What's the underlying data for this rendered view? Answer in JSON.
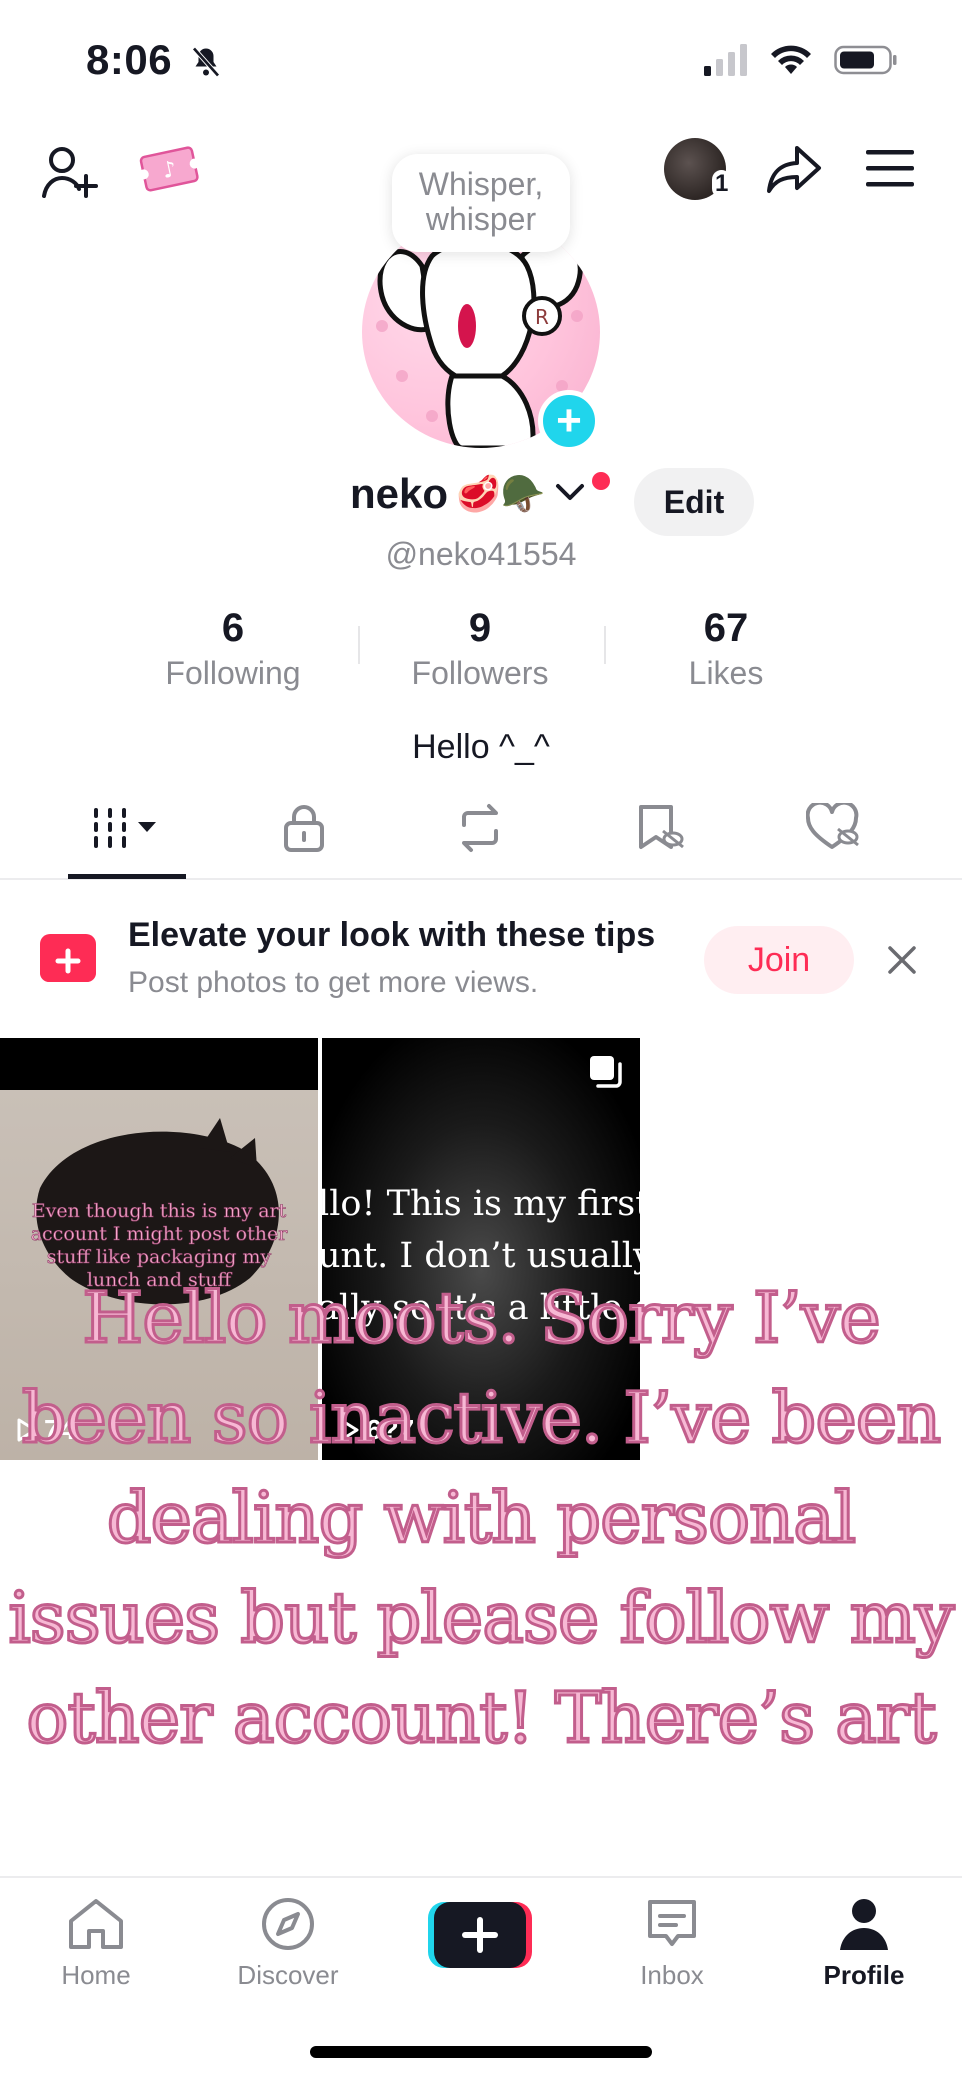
{
  "status_bar": {
    "time": "8:06"
  },
  "profile": {
    "tooltip": "Whisper, whisper",
    "display_name": "neko",
    "name_emojis": "🥩🪖",
    "handle": "@neko41554",
    "edit_label": "Edit",
    "bio": "Hello ^_^"
  },
  "stats": [
    {
      "value": "6",
      "label": "Following"
    },
    {
      "value": "9",
      "label": "Followers"
    },
    {
      "value": "67",
      "label": "Likes"
    }
  ],
  "tabs": [
    "videos-grid",
    "private-lock",
    "reposts",
    "favorites-bookmark",
    "liked-heart"
  ],
  "promo": {
    "title": "Elevate your look with these tips",
    "subtitle": "Post photos to get more views.",
    "join_label": "Join"
  },
  "videos": [
    {
      "caption": "Even though this is my art account I might post other stuff like packaging my lunch and stuff",
      "views": "74"
    },
    {
      "caption_lines": [
        "llo! This is my first",
        "unt. I don’t usually",
        "ally so it’s a little cr"
      ],
      "views": "6?7"
    }
  ],
  "overlay_text": "Hello moots. Sorry I’ve been so inactive. I’ve been dealing with personal issues but please follow my other account! There’s art",
  "bottom_nav": {
    "home": "Home",
    "discover": "Discover",
    "inbox": "Inbox",
    "profile": "Profile"
  },
  "notifications": {
    "avatar_badge": "1"
  },
  "colors": {
    "accent": "#fe2c55",
    "cyan": "#20d5ec",
    "overlay_fill": "#f7b8d4",
    "overlay_stroke": "#c25e8c"
  }
}
